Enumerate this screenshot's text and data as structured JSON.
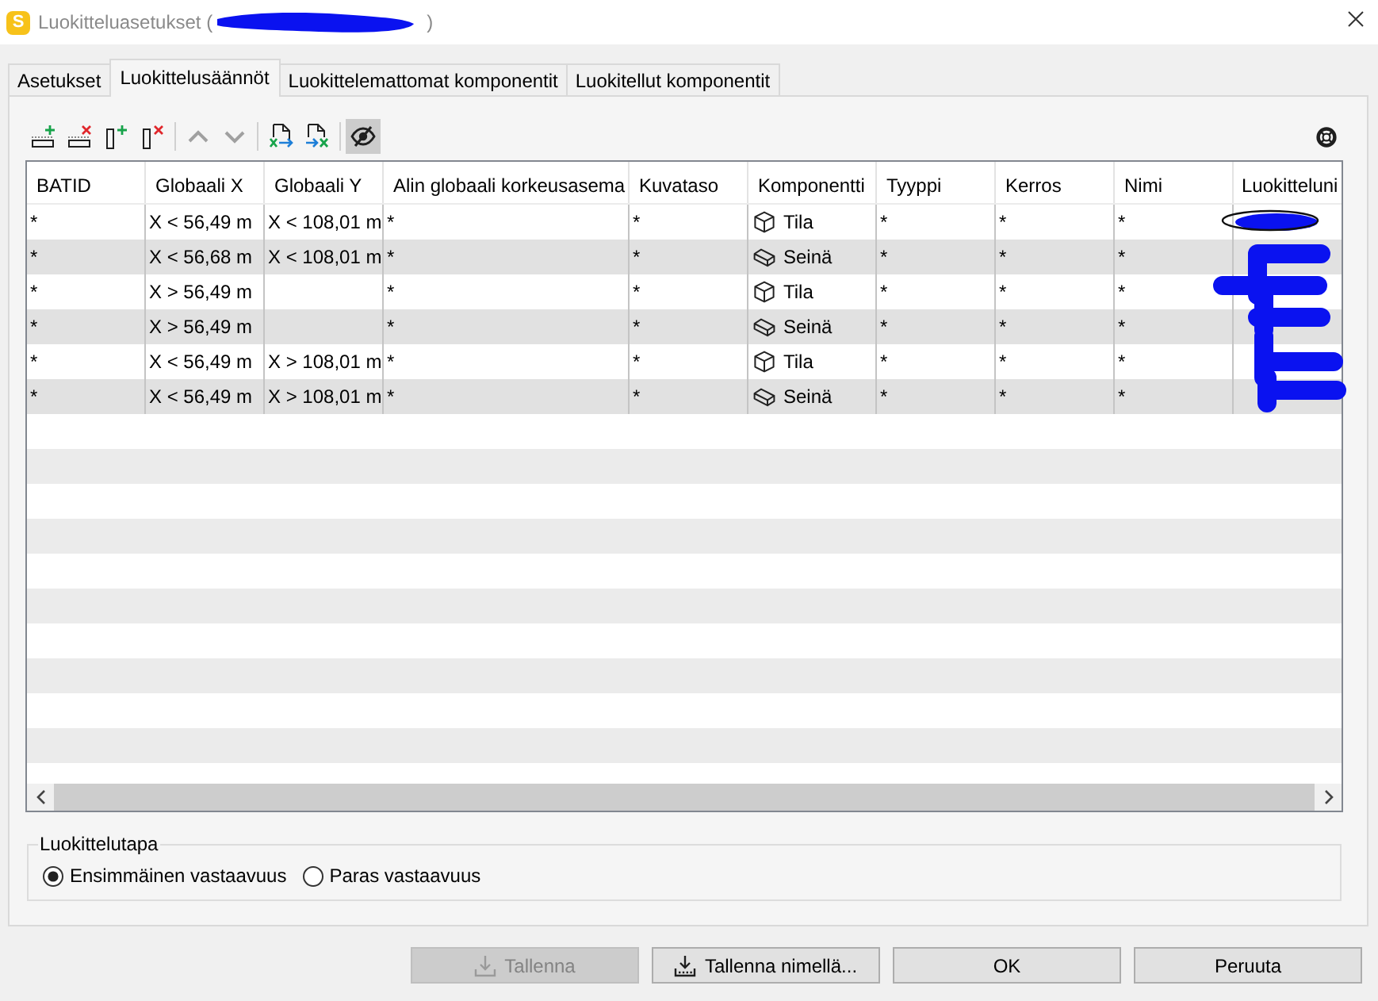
{
  "window": {
    "app_icon": "S",
    "title_start": "Luokitteluasetukset (",
    "title_end": ")"
  },
  "tabs": [
    {
      "label": "Asetukset",
      "selected": false
    },
    {
      "label": "Luokittelusäännöt",
      "selected": true
    },
    {
      "label": "Luokittelemattomat komponentit",
      "selected": false
    },
    {
      "label": "Luokitellut komponentit",
      "selected": false
    }
  ],
  "toolbar": {
    "groups": [
      [
        {
          "kind": "add-row",
          "pressed": false,
          "disabled": false
        },
        {
          "kind": "delete-row",
          "pressed": false,
          "disabled": false
        },
        {
          "kind": "add-column",
          "pressed": false,
          "disabled": false
        },
        {
          "kind": "delete-column",
          "pressed": false,
          "disabled": false
        }
      ],
      [
        {
          "kind": "move-up",
          "pressed": false,
          "disabled": true
        },
        {
          "kind": "move-down",
          "pressed": false,
          "disabled": true
        }
      ],
      [
        {
          "kind": "import",
          "pressed": false,
          "disabled": false
        },
        {
          "kind": "export",
          "pressed": false,
          "disabled": false
        }
      ],
      [
        {
          "kind": "hide",
          "pressed": true,
          "disabled": false
        }
      ]
    ],
    "end": [
      {
        "kind": "help",
        "pressed": false,
        "disabled": false
      }
    ]
  },
  "table": {
    "columns": [
      "BATID",
      "Globaali X",
      "Globaali Y",
      "Alin globaali korkeusasema",
      "Kuvataso",
      "Komponentti",
      "Tyyppi",
      "Kerros",
      "Nimi",
      "Luokitteluni"
    ],
    "rows": [
      {
        "batid": "*",
        "globaali_x": "X < 56,49 m",
        "globaali_y": "X < 108,01 m",
        "alin_globaali_korkeusasema": "*",
        "kuvataso": "*",
        "komponentti": {
          "kind": "space",
          "label": "Tila"
        },
        "tyyppi": "*",
        "kerros": "*",
        "nimi": "*"
      },
      {
        "batid": "*",
        "globaali_x": "X < 56,68 m",
        "globaali_y": "X < 108,01 m",
        "alin_globaali_korkeusasema": "*",
        "kuvataso": "*",
        "komponentti": {
          "kind": "wall",
          "label": "Seinä"
        },
        "tyyppi": "*",
        "kerros": "*",
        "nimi": "*"
      },
      {
        "batid": "*",
        "globaali_x": "X > 56,49 m",
        "alin_globaali_korkeusasema": "*",
        "kuvataso": "*",
        "komponentti": {
          "kind": "space",
          "label": "Tila"
        },
        "tyyppi": "*",
        "kerros": "*",
        "nimi": "*"
      },
      {
        "batid": "*",
        "globaali_x": "X > 56,49 m",
        "alin_globaali_korkeusasema": "*",
        "kuvataso": "*",
        "komponentti": {
          "kind": "wall",
          "label": "Seinä"
        },
        "tyyppi": "*",
        "kerros": "*",
        "nimi": "*"
      },
      {
        "batid": "*",
        "globaali_x": "X < 56,49 m",
        "globaali_y": "X > 108,01 m",
        "alin_globaali_korkeusasema": "*",
        "kuvataso": "*",
        "komponentti": {
          "kind": "space",
          "label": "Tila"
        },
        "tyyppi": "*",
        "kerros": "*",
        "nimi": "*"
      },
      {
        "batid": "*",
        "globaali_x": "X < 56,49 m",
        "globaali_y": "X > 108,01 m",
        "alin_globaali_korkeusasema": "*",
        "kuvataso": "*",
        "komponentti": {
          "kind": "wall",
          "label": "Seinä"
        },
        "tyyppi": "*",
        "kerros": "*",
        "nimi": "*"
      }
    ]
  },
  "classification": {
    "label": "Luokittelutapa",
    "options": [
      {
        "label": "Ensimmäinen vastaavuus",
        "selected": true
      },
      {
        "label": "Paras vastaavuus",
        "selected": false
      }
    ]
  },
  "buttons": [
    {
      "kind": "save",
      "label": "Tallenna",
      "disabled": true
    },
    {
      "kind": "save-as",
      "label": "Tallenna nimellä...",
      "disabled": false
    },
    {
      "kind": "plain",
      "label": "OK",
      "disabled": false
    },
    {
      "kind": "plain",
      "label": "Peruuta",
      "disabled": false
    }
  ]
}
